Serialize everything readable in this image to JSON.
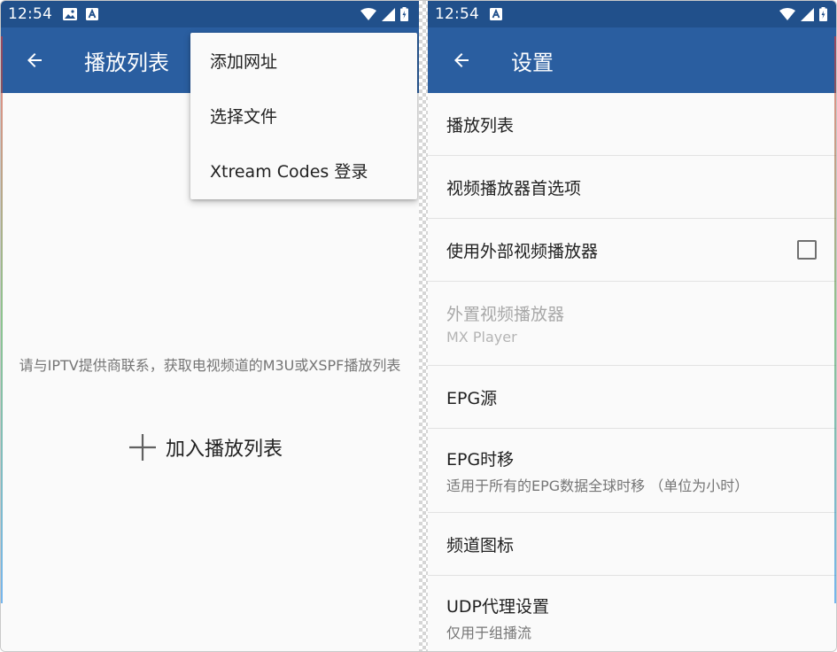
{
  "left": {
    "status": {
      "time": "12:54"
    },
    "appbar": {
      "title": "播放列表"
    },
    "menu": {
      "items": [
        {
          "label": "添加网址"
        },
        {
          "label": "选择文件"
        },
        {
          "label": "Xtream Codes 登录"
        }
      ]
    },
    "empty_message": "请与IPTV提供商联系，获取电视频道的M3U或XSPF播放列表",
    "add_button": {
      "label": "加入播放列表"
    }
  },
  "right": {
    "status": {
      "time": "12:54"
    },
    "appbar": {
      "title": "设置"
    },
    "settings": [
      {
        "title": "播放列表",
        "subtitle": ""
      },
      {
        "title": "视频播放器首选项",
        "subtitle": ""
      },
      {
        "title": "使用外部视频播放器",
        "subtitle": "",
        "checked": false
      },
      {
        "title": "外置视频播放器",
        "subtitle": "MX Player",
        "enabled": false
      },
      {
        "title": "EPG源",
        "subtitle": ""
      },
      {
        "title": "EPG时移",
        "subtitle": "适用于所有的EPG数据全球时移 （单位为小时）"
      },
      {
        "title": "频道图标",
        "subtitle": ""
      },
      {
        "title": "UDP代理设置",
        "subtitle": "仅用于组播流"
      }
    ]
  },
  "theme": {
    "status_bar": "#21508b",
    "app_bar": "#2a5ea0",
    "background": "#fafafa"
  },
  "icons": [
    "back-arrow-icon",
    "image-icon",
    "a-box-icon",
    "wifi-icon",
    "signal-icon",
    "battery-icon",
    "plus-icon"
  ]
}
